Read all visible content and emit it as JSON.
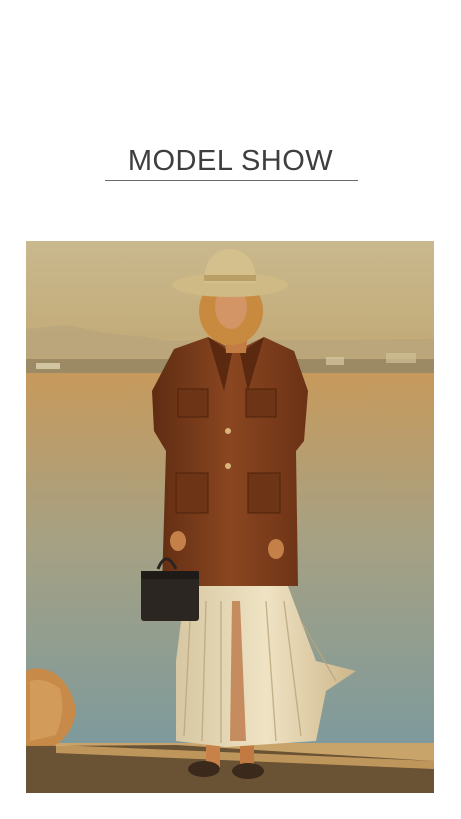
{
  "section": {
    "title": "MODEL SHOW"
  },
  "photo": {
    "subject": "model-photo",
    "colors": {
      "sky_top": "#c9b98e",
      "sky_bottom": "#c1a874",
      "water_top": "#c79a5c",
      "water_bottom": "#7e9a9c",
      "coat": "#7a3d1c",
      "hat": "#d4c08c",
      "ground": "#6a5234"
    }
  }
}
